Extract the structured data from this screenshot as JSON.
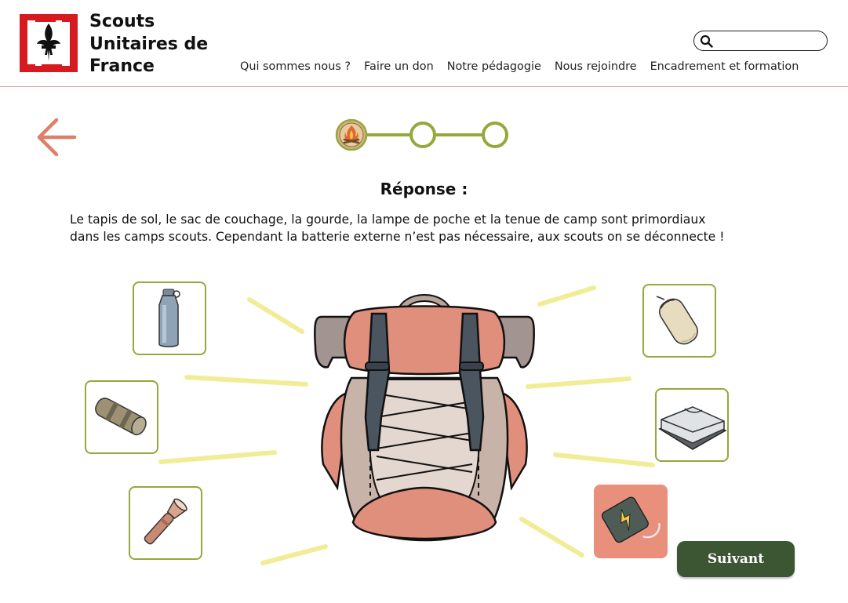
{
  "header": {
    "brand_lines": [
      "Scouts",
      "Unitaires de",
      "France"
    ],
    "search": {
      "value": "",
      "placeholder": ""
    },
    "nav": [
      "Qui sommes nous ?",
      "Faire un don",
      "Notre pédagogie",
      "Nous rejoindre",
      "Encadrement et formation"
    ]
  },
  "progress": {
    "current_step": 1,
    "total_steps": 3
  },
  "main": {
    "title": "Réponse :",
    "answer_lines": [
      "Le tapis de sol, le sac de couchage, la gourde, la lampe de poche et la tenue de camp sont primordiaux",
      "dans les camps scouts. Cependant la batterie externe n’est pas nécessaire, aux scouts on se déconnecte !"
    ]
  },
  "items": [
    {
      "name": "gourde",
      "icon": "water-bottle-icon",
      "correct": true
    },
    {
      "name": "tapis de sol",
      "icon": "sleeping-mat-icon",
      "correct": true
    },
    {
      "name": "lampe de poche",
      "icon": "flashlight-icon",
      "correct": true
    },
    {
      "name": "sac de couchage",
      "icon": "sleeping-bag-icon",
      "correct": true
    },
    {
      "name": "tenue de camp",
      "icon": "folded-clothes-icon",
      "correct": true
    },
    {
      "name": "batterie externe",
      "icon": "power-bank-icon",
      "correct": false
    }
  ],
  "buttons": {
    "next_label": "Suivant"
  },
  "colors": {
    "accent_green": "#94a83b",
    "button_green": "#3c5533",
    "brand_red": "#d71920",
    "wrong_bg": "#e8907c",
    "back_arrow": "#de7f68"
  }
}
